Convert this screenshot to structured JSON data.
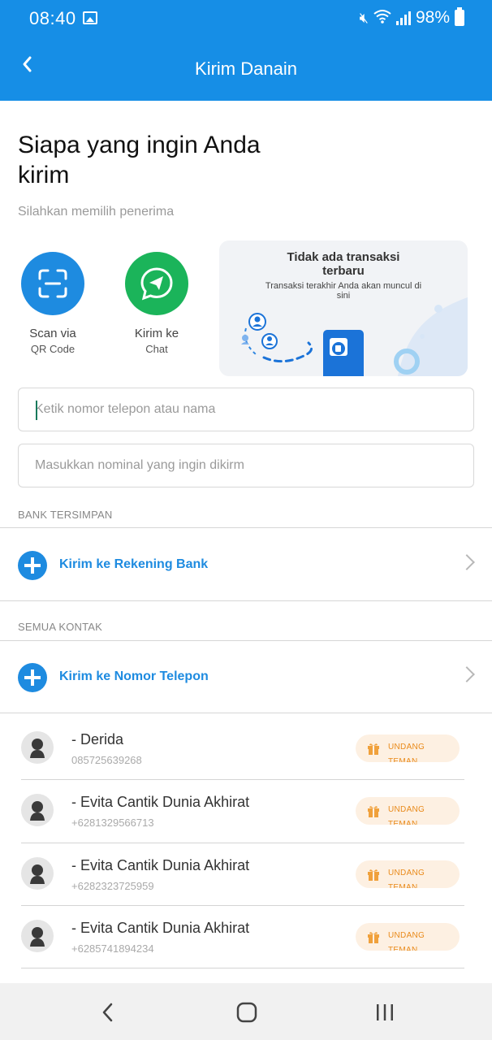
{
  "status_bar": {
    "time": "08:40",
    "battery": "98%"
  },
  "app_bar": {
    "title": "Kirim Danain"
  },
  "header": {
    "title": "Siapa yang ingin Anda kirim",
    "subtitle": "Silahkan memilih penerima"
  },
  "quick_actions": [
    {
      "label": "Scan via",
      "sublabel": "QR Code",
      "icon": "qr-scan-icon",
      "color": "#1e8be0"
    },
    {
      "label": "Kirim ke",
      "sublabel": "Chat",
      "icon": "chat-send-icon",
      "color": "#1bb45a"
    }
  ],
  "recent_card": {
    "title": "Tidak ada transaksi terbaru",
    "subtitle": "Transaksi terakhir Anda akan muncul di sini"
  },
  "inputs": {
    "recipient_placeholder": "Ketik nomor telepon atau nama",
    "amount_placeholder": "Masukkan nominal yang ingin dikirm"
  },
  "sections": {
    "saved_bank_label": "BANK TERSIMPAN",
    "bank_action_label": "Kirim ke Rekening Bank",
    "all_contacts_label": "SEMUA KONTAK",
    "phone_action_label": "Kirim ke Nomor Telepon"
  },
  "contacts": [
    {
      "name": "- Derida",
      "phone": "085725639268",
      "invite": "UNDANG TEMAN"
    },
    {
      "name": "- Evita Cantik Dunia Akhirat",
      "phone": "+6281329566713",
      "invite": "UNDANG TEMAN"
    },
    {
      "name": "- Evita Cantik Dunia Akhirat",
      "phone": "+6282323725959",
      "invite": "UNDANG TEMAN"
    },
    {
      "name": "- Evita Cantik Dunia Akhirat",
      "phone": "+6285741894234",
      "invite": "UNDANG TEMAN"
    }
  ],
  "colors": {
    "primary": "#168ee6",
    "accent_blue": "#1e8be0",
    "whatsapp_green": "#1bb45a",
    "invite_orange": "#e98a1a"
  }
}
